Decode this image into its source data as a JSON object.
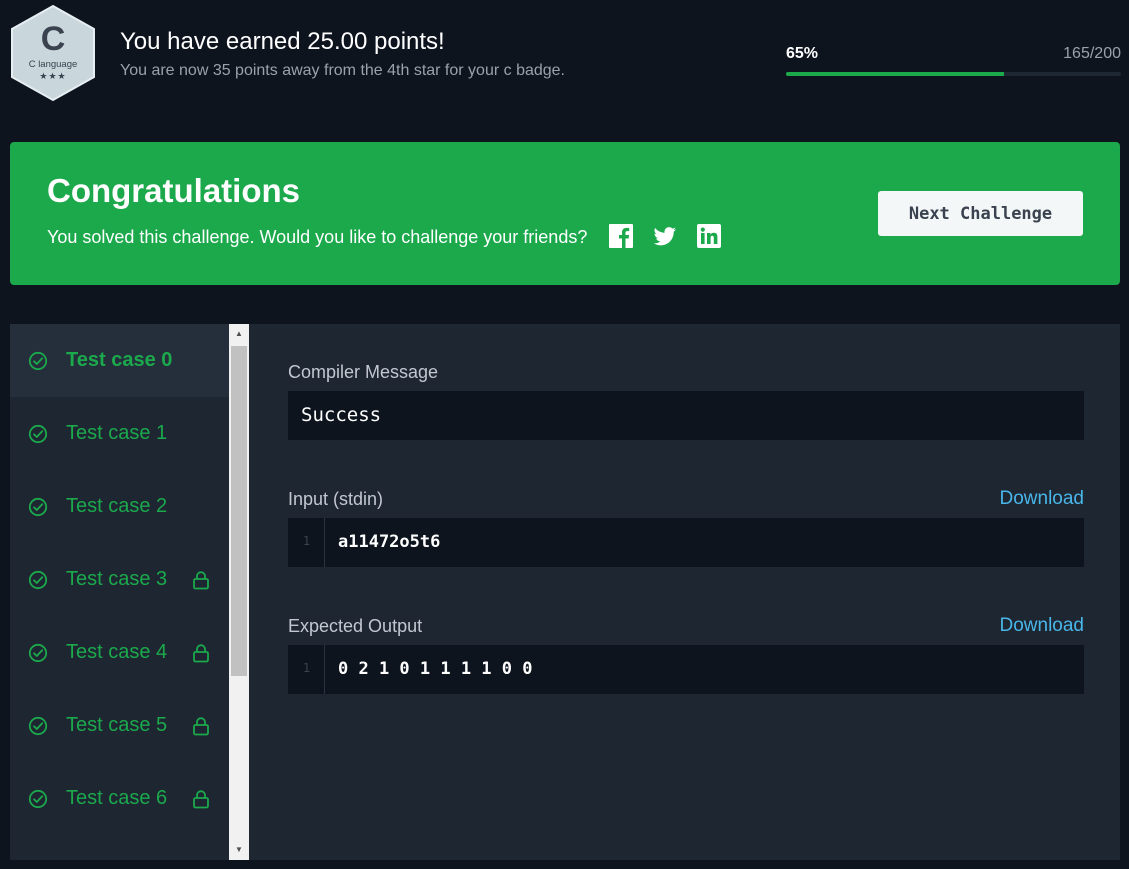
{
  "header": {
    "badge": {
      "letter": "C",
      "name": "C language",
      "stars": "★★★",
      "star_count": 3
    },
    "earned_title": "You have earned 25.00 points!",
    "earned_subtitle": "You are now 35 points away from the 4th star for your c badge.",
    "progress": {
      "percent_label": "65%",
      "value": 0.65,
      "count_label": "165/200"
    }
  },
  "banner": {
    "title": "Congratulations",
    "text": "You solved this challenge. Would you like to challenge your friends?",
    "share_icons": [
      "facebook-icon",
      "twitter-icon",
      "linkedin-icon"
    ],
    "next_button": "Next Challenge",
    "color": "#1ba94c"
  },
  "test_cases": [
    {
      "label": "Test case 0",
      "locked": false,
      "active": true
    },
    {
      "label": "Test case 1",
      "locked": false,
      "active": false
    },
    {
      "label": "Test case 2",
      "locked": false,
      "active": false
    },
    {
      "label": "Test case 3",
      "locked": true,
      "active": false
    },
    {
      "label": "Test case 4",
      "locked": true,
      "active": false
    },
    {
      "label": "Test case 5",
      "locked": true,
      "active": false
    },
    {
      "label": "Test case 6",
      "locked": true,
      "active": false
    }
  ],
  "output": {
    "compiler_label": "Compiler Message",
    "compiler_message": "Success",
    "input_label": "Input (stdin)",
    "input_download": "Download",
    "input_line_no": "1",
    "input_value": "a11472o5t6",
    "expected_label": "Expected Output",
    "expected_download": "Download",
    "expected_line_no": "1",
    "expected_value": "0 2 1 0 1 1 1 1 0 0"
  },
  "colors": {
    "background": "#0e141e",
    "panel": "#1e2632",
    "success_green": "#1ba94c",
    "link_blue": "#49b6e9"
  }
}
